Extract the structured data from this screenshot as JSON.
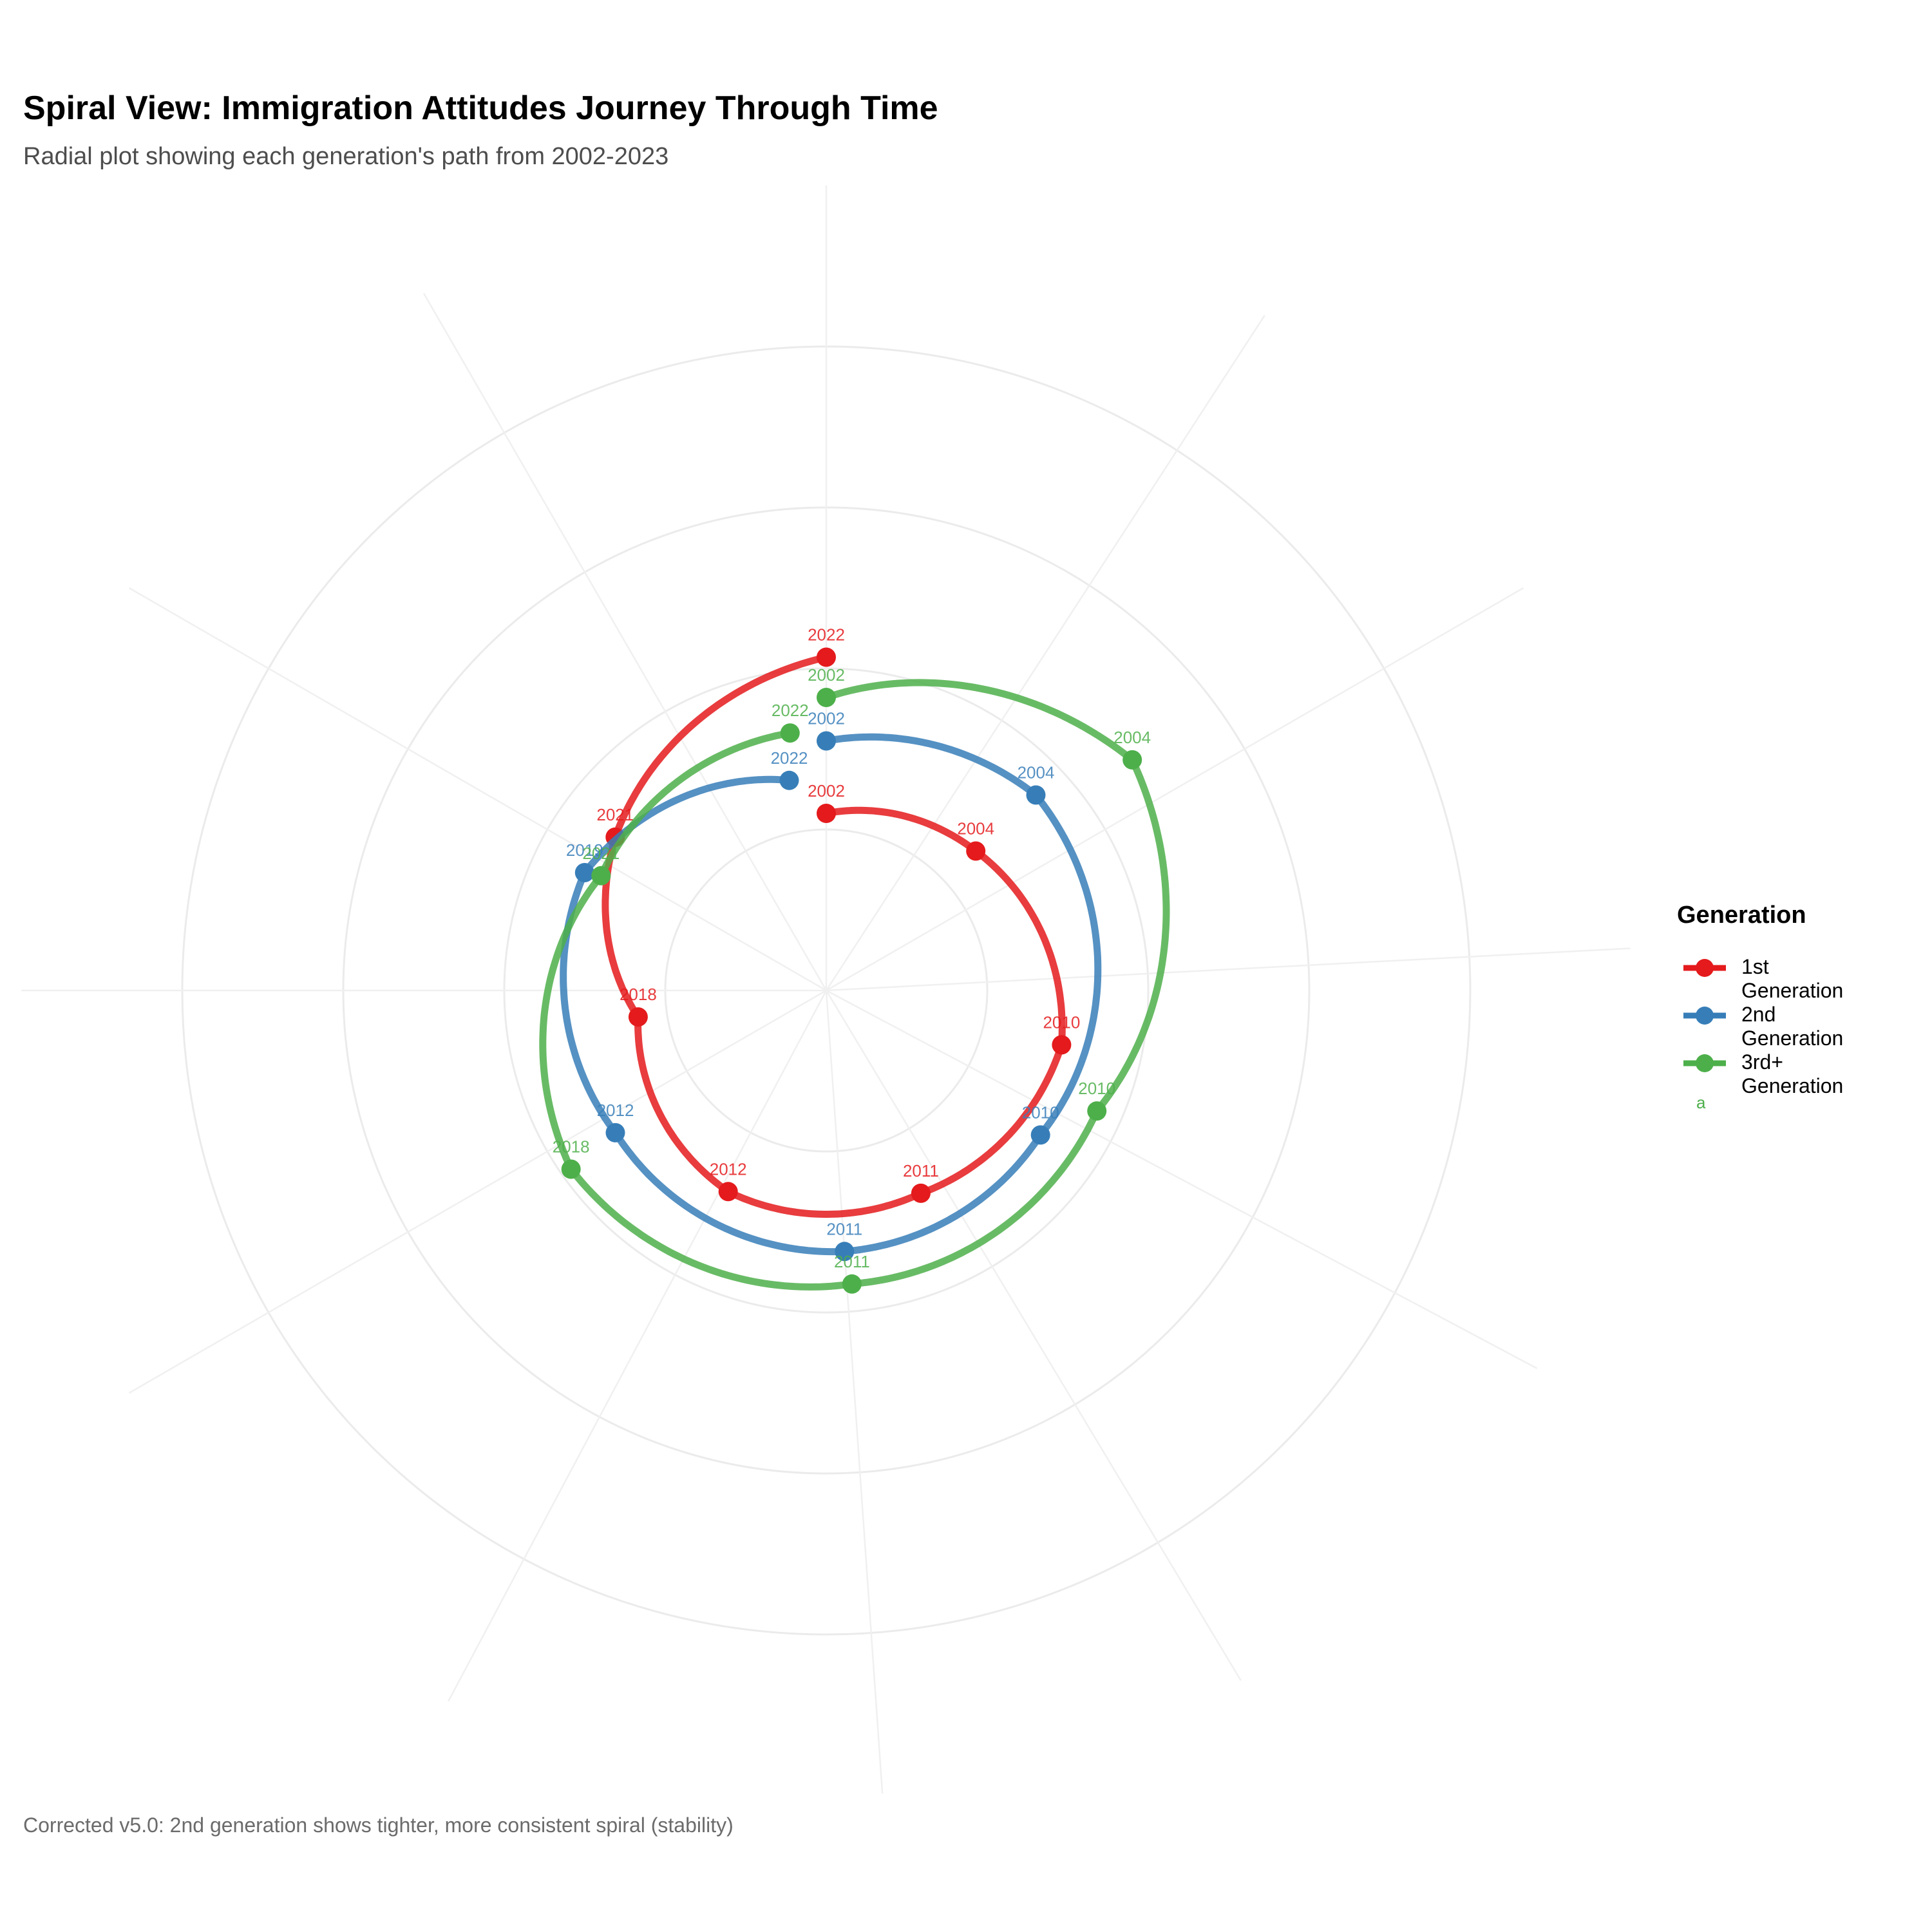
{
  "title": "Spiral View: Immigration Attitudes Journey Through Time",
  "subtitle": "Radial plot showing each generation's path from 2002-2023",
  "caption": "Corrected v5.0: 2nd generation shows tighter, more consistent spiral (stability)",
  "legend": {
    "title": "Generation",
    "note": "a",
    "items": [
      {
        "label": "1st Generation",
        "color": "#e41a1c"
      },
      {
        "label": "2nd Generation",
        "color": "#377eb8"
      },
      {
        "label": "3rd+ Generation",
        "color": "#4daf4a"
      }
    ]
  },
  "chart_data": {
    "type": "line",
    "coordinate_system": "polar",
    "grid": true,
    "legend_position": "right",
    "series": [
      {
        "name": "1st Generation",
        "color": "#e41a1c",
        "points": [
          {
            "label": "2002",
            "angle_deg": 0,
            "radius": 2.2
          },
          {
            "label": "2004",
            "angle_deg": 47,
            "radius": 2.54
          },
          {
            "label": "2010",
            "angle_deg": 103,
            "radius": 3.0
          },
          {
            "label": "2011",
            "angle_deg": 155,
            "radius": 2.78
          },
          {
            "label": "2012",
            "angle_deg": 206,
            "radius": 2.78
          },
          {
            "label": "2018",
            "angle_deg": 262,
            "radius": 2.36
          },
          {
            "label": "2021",
            "angle_deg": 306,
            "radius": 3.24
          },
          {
            "label": "2022",
            "angle_deg": 360,
            "radius": 4.14
          }
        ]
      },
      {
        "name": "2nd Generation",
        "color": "#377eb8",
        "points": [
          {
            "label": "2002",
            "angle_deg": 0,
            "radius": 3.1
          },
          {
            "label": "2004",
            "angle_deg": 47,
            "radius": 3.56
          },
          {
            "label": "2010",
            "angle_deg": 124,
            "radius": 3.21
          },
          {
            "label": "2011",
            "angle_deg": 176,
            "radius": 3.25
          },
          {
            "label": "2012",
            "angle_deg": 236,
            "radius": 3.16
          },
          {
            "label": "2019",
            "angle_deg": 296,
            "radius": 3.34
          },
          {
            "label": "2022",
            "angle_deg": 350,
            "radius": 2.65
          }
        ]
      },
      {
        "name": "3rd+ Generation",
        "color": "#4daf4a",
        "points": [
          {
            "label": "2002",
            "angle_deg": 0,
            "radius": 3.64
          },
          {
            "label": "2004",
            "angle_deg": 53,
            "radius": 4.76
          },
          {
            "label": "2010",
            "angle_deg": 114,
            "radius": 3.68
          },
          {
            "label": "2011",
            "angle_deg": 175,
            "radius": 3.66
          },
          {
            "label": "2018",
            "angle_deg": 235,
            "radius": 3.87
          },
          {
            "label": "2021",
            "angle_deg": 297,
            "radius": 3.14
          },
          {
            "label": "2022",
            "angle_deg": 352,
            "radius": 3.23
          }
        ]
      }
    ]
  }
}
